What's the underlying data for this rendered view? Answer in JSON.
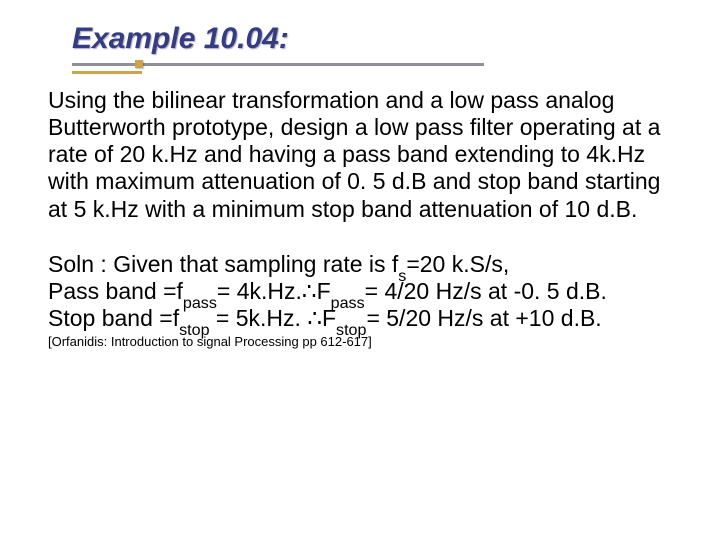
{
  "title": "Example 10.04:",
  "problem": "Using the bilinear transformation and a low pass analog Butterworth prototype, design a low pass filter operating at a rate of 20 k.Hz and having a pass band extending to 4k.Hz with maximum attenuation of 0. 5 d.B and stop band starting at 5 k.Hz with a minimum stop band attenuation of 10 d.B.",
  "soln": {
    "line1_a": "Soln : Given that sampling rate is f",
    "line1_sub": "s",
    "line1_b": "=20 k.S/s,",
    "line2_a": "Pass band =f",
    "line2_sub1": "pass",
    "line2_b": "= 4k.Hz.",
    "line2_c": "F",
    "line2_sub2": "pass",
    "line2_d": "= 4/20 Hz/s at -0. 5 d.B.",
    "line3_a": "Stop band =f",
    "line3_sub1": "stop",
    "line3_b": " = 5k.Hz. ",
    "line3_c": "F",
    "line3_sub2": "stop",
    "line3_d": "= 5/20 Hz/s at +10 d.B."
  },
  "therefore": "∴",
  "citation": "[Orfanidis:  Introduction to signal Processing pp 612-617]"
}
